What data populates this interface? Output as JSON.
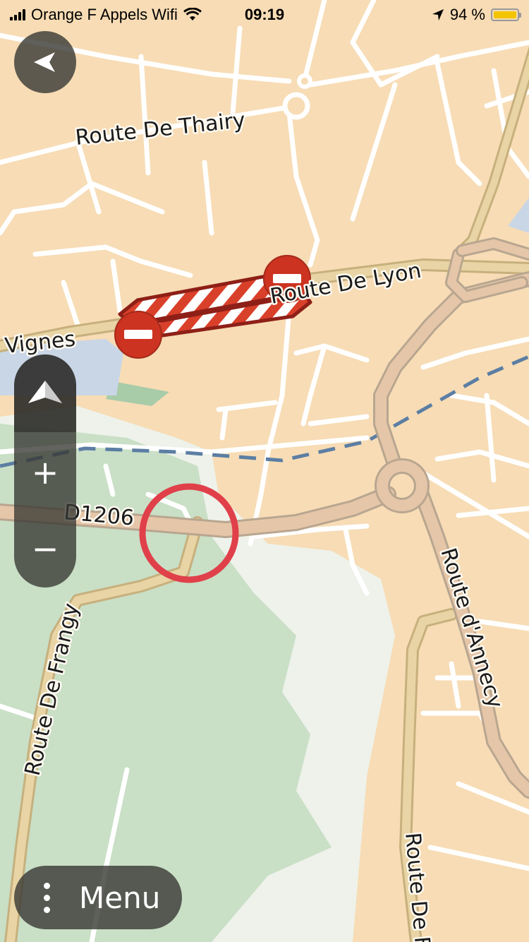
{
  "status_bar": {
    "carrier": "Orange F Appels Wifi",
    "time": "09:19",
    "battery": "94 %"
  },
  "map": {
    "street_labels": {
      "thairy": "Route De Thairy",
      "lyon": "Route De Lyon",
      "vignes": "Vignes",
      "d1206": "D1206",
      "frangy": "Route De Frangy",
      "annecy": "Route d'Annecy",
      "route_de_f": "Route De F"
    }
  },
  "controls": {
    "zoom_in": "+",
    "zoom_out": "−",
    "menu_label": "Menu"
  },
  "icons": {
    "back": "back-arrow-icon",
    "compass": "compass-north-icon",
    "menu": "vertical-dots-icon",
    "road_closed": "no-entry-icon"
  },
  "colors": {
    "land": "#f7dcb5",
    "green_area": "#c9dfc6",
    "water": "#c9d6e6",
    "major_road": "#e6c6a8",
    "secondary_road": "#e8d4a4",
    "closure_red": "#cc3320",
    "marker_ring": "#e0404a"
  }
}
